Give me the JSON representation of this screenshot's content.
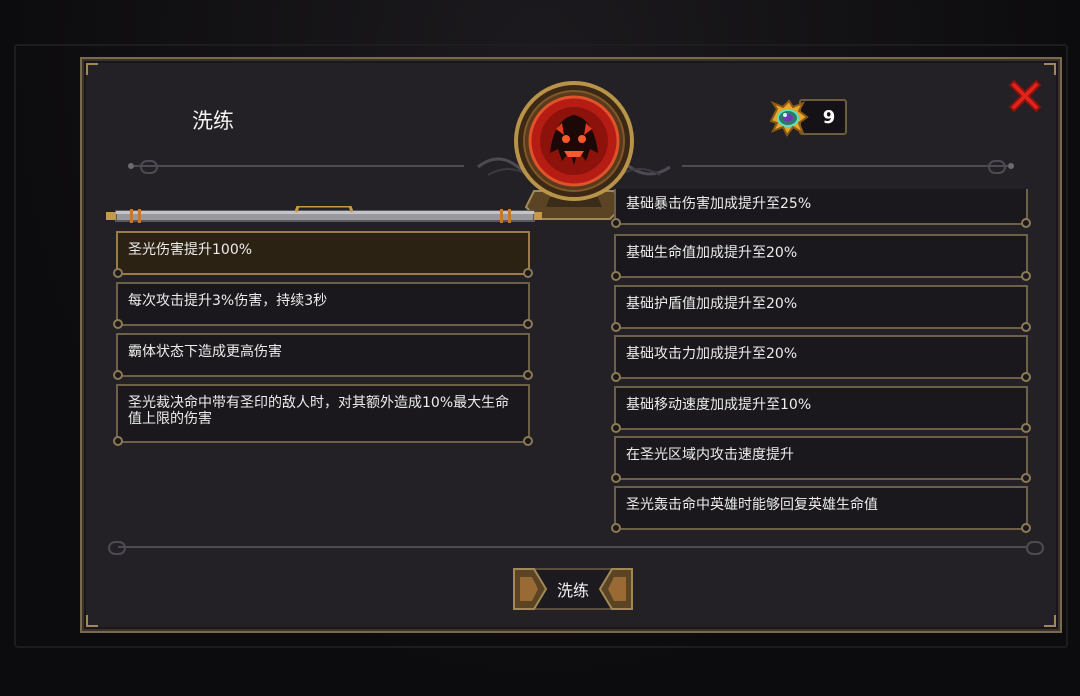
{
  "dialog": {
    "title": "洗练",
    "close_icon": "close-x-icon",
    "accent_color": "#e0241c",
    "frame_color": "#7a6a4c"
  },
  "currency": {
    "icon": "spirit-orb-gem-icon",
    "count": "9"
  },
  "emblem": {
    "icon": "red-beast-crest-icon"
  },
  "left_effects": [
    {
      "text": "圣光伤害提升100%",
      "selected": true
    },
    {
      "text": "每次攻击提升3%伤害，持续3秒",
      "selected": false
    },
    {
      "text": "霸体状态下造成更高伤害",
      "selected": false
    },
    {
      "text": "圣光裁决命中带有圣印的敌人时，对其额外造成10%最大生命值上限的伤害",
      "selected": false
    }
  ],
  "right_effects": [
    {
      "text": "基础暴击伤害加成提升至25%"
    },
    {
      "text": "基础生命值加成提升至20%"
    },
    {
      "text": "基础护盾值加成提升至20%"
    },
    {
      "text": "基础攻击力加成提升至20%"
    },
    {
      "text": "基础移动速度加成提升至10%"
    },
    {
      "text": "在圣光区域内攻击速度提升"
    },
    {
      "text": "圣光轰击命中英雄时能够回复英雄生命值"
    }
  ],
  "refine_button": {
    "label": "洗练"
  }
}
